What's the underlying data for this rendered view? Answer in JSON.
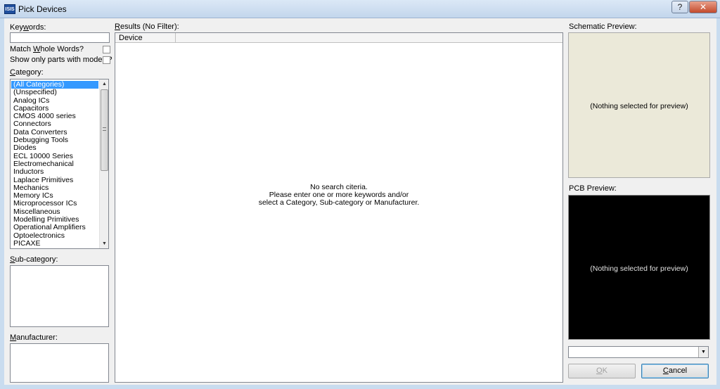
{
  "window": {
    "title": "Pick Devices",
    "app_icon_text": "ISIS",
    "help_label": "?",
    "close_label": "✕"
  },
  "left": {
    "keywords_label_pre": "Key",
    "keywords_label_u": "w",
    "keywords_label_post": "ords:",
    "keywords_value": "",
    "match_label_pre": "Match ",
    "match_label_u": "W",
    "match_label_post": "hole Words?",
    "models_label": "Show only parts with models?",
    "category_label_u": "C",
    "category_label_post": "ategory:",
    "categories": [
      "(All Categories)",
      "(Unspecified)",
      "Analog ICs",
      "Capacitors",
      "CMOS 4000 series",
      "Connectors",
      "Data Converters",
      "Debugging Tools",
      "Diodes",
      "ECL 10000 Series",
      "Electromechanical",
      "Inductors",
      "Laplace Primitives",
      "Mechanics",
      "Memory ICs",
      "Microprocessor ICs",
      "Miscellaneous",
      "Modelling Primitives",
      "Operational Amplifiers",
      "Optoelectronics",
      "PICAXE"
    ],
    "selected_category": 0,
    "subcategory_label_u": "S",
    "subcategory_label_post": "ub-category:",
    "manufacturer_label_u": "M",
    "manufacturer_label_post": "anufacturer:"
  },
  "results": {
    "label_u": "R",
    "label_post": "esults (No Filter):",
    "column_device": "Device",
    "empty_line1": "No search citeria.",
    "empty_line2": "Please enter one or more keywords and/or",
    "empty_line3": "select a Category, Sub-category or Manufacturer."
  },
  "preview": {
    "schematic_label": "Schematic Preview:",
    "schematic_msg": "(Nothing selected for preview)",
    "pcb_label": "PCB Preview:",
    "pcb_msg": "(Nothing selected for preview)",
    "combo_value": ""
  },
  "buttons": {
    "ok_u": "O",
    "ok_post": "K",
    "cancel_u": "C",
    "cancel_post": "ancel"
  },
  "colors": {
    "selection": "#3399ff",
    "schematic_bg": "#ebe9d9",
    "pcb_bg": "#000000"
  }
}
